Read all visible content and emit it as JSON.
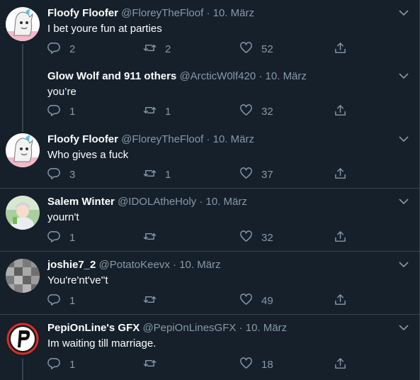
{
  "tweets": [
    {
      "name": "Floofy Floofer",
      "handle": "@FloreyTheFloof",
      "date": "10. März",
      "text": "I bet youre fun at parties",
      "replies": "2",
      "retweets": "2",
      "likes": "52",
      "avatar": "floof"
    },
    {
      "name": "Glow Wolf and 911 others",
      "handle": "@ArcticW0lf420",
      "date": "10. März",
      "text": "you’re",
      "replies": "1",
      "retweets": "1",
      "likes": "32",
      "avatar": "none"
    },
    {
      "name": "Floofy Floofer",
      "handle": "@FloreyTheFloof",
      "date": "10. März",
      "text": "Who gives a fuck",
      "replies": "3",
      "retweets": "1",
      "likes": "37",
      "avatar": "floof"
    },
    {
      "name": "Salem Winter",
      "handle": "@IDOLAtheHoly",
      "date": "10. März",
      "text": "yourn't",
      "replies": "1",
      "retweets": "",
      "likes": "32",
      "avatar": "salem"
    },
    {
      "name": "joshie7_2",
      "handle": "@PotatoKeevx",
      "date": "10. März",
      "text": "You're'nt've''t",
      "replies": "1",
      "retweets": "",
      "likes": "49",
      "avatar": "joshie"
    },
    {
      "name": "PepiOnLine's GFX",
      "handle": "@PepiOnLinesGFX",
      "date": "10. März",
      "text": "Im waiting till marriage.",
      "replies": "1",
      "retweets": "",
      "likes": "18",
      "avatar": "pepi"
    }
  ],
  "separator_dot": "·",
  "colors": {
    "background": "#15202b",
    "muted": "#8899a6",
    "border": "#38444d"
  }
}
